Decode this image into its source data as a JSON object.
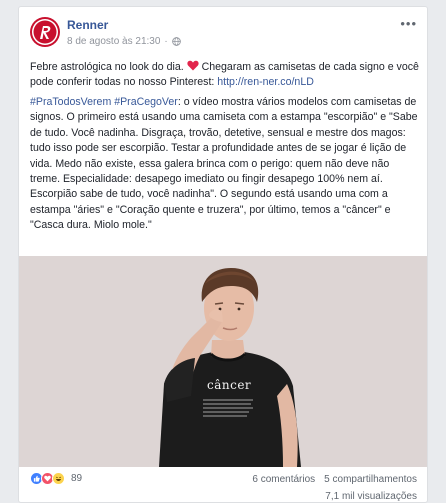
{
  "post": {
    "page_name": "Renner",
    "timestamp": "8 de agosto às 21:30",
    "dot": "·",
    "more": "•••",
    "text1_a": "Febre astrológica no look do dia.",
    "text1_b": "Chegaram as camisetas de cada signo e você pode conferir todas no nosso Pinterest:",
    "link": "http://ren-ner.co/nLD",
    "hashtags": "#PraTodosVerem #PraCegoVer",
    "text2": ": o vídeo mostra vários modelos com camisetas de signos. O primeiro está usando uma camiseta com a estampa \"escorpião\" e \"Sabe de tudo. Você nadinha. Disgraça, trovão, detetive, sensual e mestre dos magos: tudo isso pode ser escorpião. Testar a profundidade antes de se jogar é lição de vida. Medo não existe, essa galera brinca com o perigo: quem não deve não treme. Especialidade: desapego imediato ou fingir desapego 100% nem aí. Escorpião sabe de tudo, você nadinha\". O segundo está usando uma com a estampa \"áries\" e \"Coração quente e truzera\", por último, temos a \"câncer\" e \"Casca dura. Miolo mole.\"",
    "shirt_text": "câncer"
  },
  "footer": {
    "reaction_count": "89",
    "comments": "6 comentários",
    "shares": "5 compartilhamentos",
    "views": "7,1 mil visualizações"
  },
  "colors": {
    "brand": "#c8102e",
    "link": "#385898",
    "background": "#e9ebee"
  },
  "icons": [
    "renner-logo",
    "globe-icon",
    "heart-emoji",
    "like-reaction-icon",
    "love-reaction-icon",
    "haha-reaction-icon",
    "more-options-icon"
  ]
}
